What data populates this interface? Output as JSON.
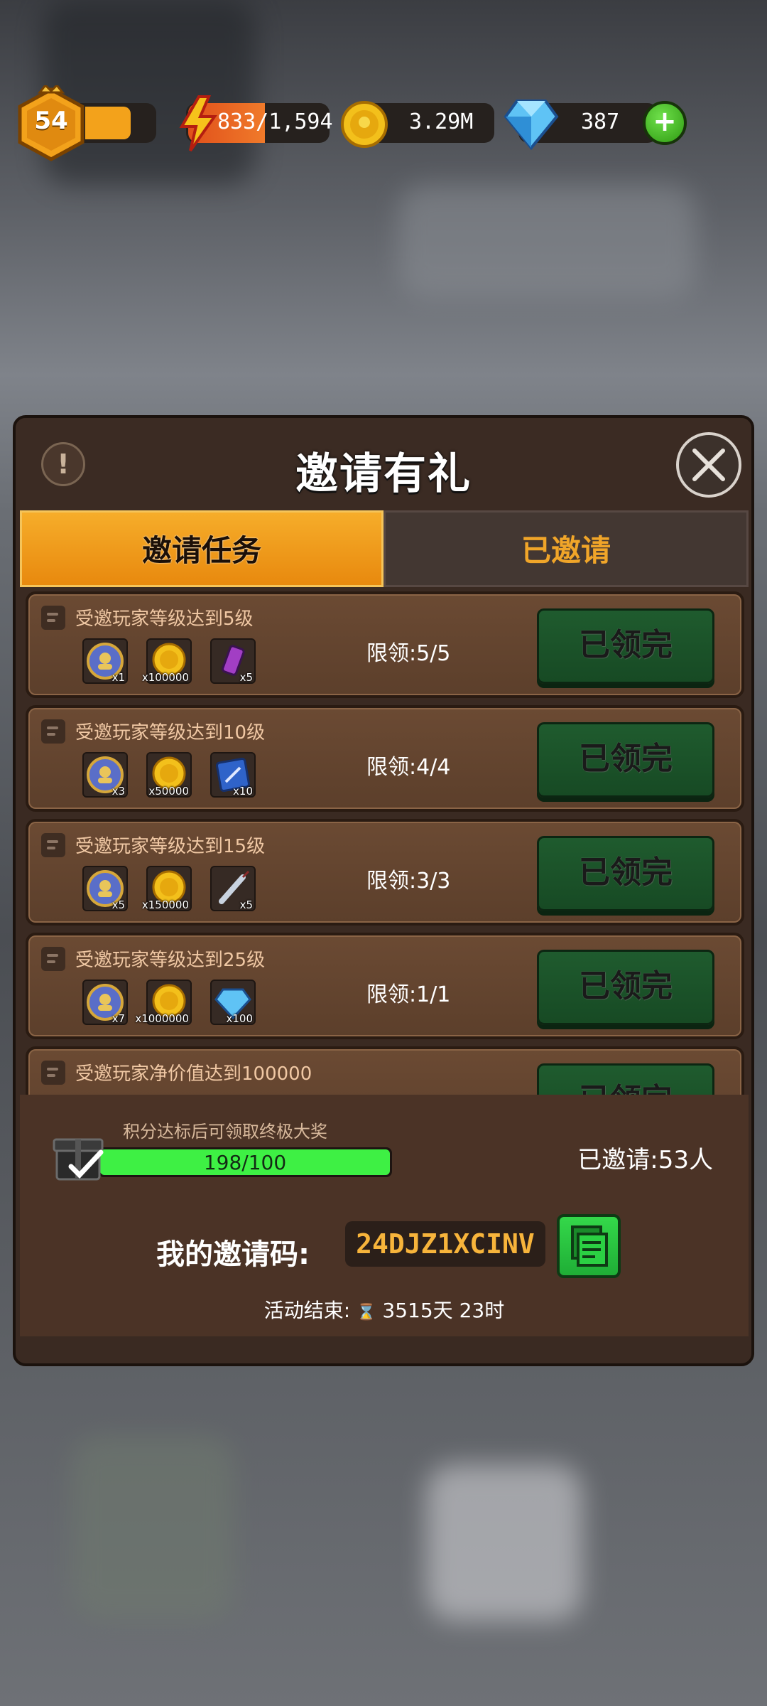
{
  "hud": {
    "level": "54",
    "energy": "833/1,594",
    "coins": "3.29M",
    "gems": "387",
    "add_gems": "+"
  },
  "dialog": {
    "title": "邀请有礼",
    "info_glyph": "!",
    "tabs": [
      {
        "label": "邀请任务",
        "active": true
      },
      {
        "label": "已邀请",
        "active": false
      }
    ],
    "rows": [
      {
        "title": "受邀玩家等级达到5级",
        "limit": "限领:5/5",
        "button": "已领完",
        "rewards": [
          {
            "icon": "emblem-icon",
            "qty": "x1"
          },
          {
            "icon": "gold-coin-icon",
            "qty": "x100000"
          },
          {
            "icon": "energy-can-icon",
            "qty": "x5"
          }
        ]
      },
      {
        "title": "受邀玩家等级达到10级",
        "limit": "限领:4/4",
        "button": "已领完",
        "rewards": [
          {
            "icon": "emblem-icon",
            "qty": "x3"
          },
          {
            "icon": "gold-coin-icon",
            "qty": "x50000"
          },
          {
            "icon": "blueprint-icon",
            "qty": "x10"
          }
        ]
      },
      {
        "title": "受邀玩家等级达到15级",
        "limit": "限领:3/3",
        "button": "已领完",
        "rewards": [
          {
            "icon": "emblem-icon",
            "qty": "x5"
          },
          {
            "icon": "gold-coin-icon",
            "qty": "x150000"
          },
          {
            "icon": "syringe-icon",
            "qty": "x5"
          }
        ]
      },
      {
        "title": "受邀玩家等级达到25级",
        "limit": "限领:1/1",
        "button": "已领完",
        "rewards": [
          {
            "icon": "emblem-icon",
            "qty": "x7"
          },
          {
            "icon": "gold-coin-icon",
            "qty": "x1000000"
          },
          {
            "icon": "diamond-icon",
            "qty": "x100"
          }
        ]
      },
      {
        "title": "受邀玩家净价值达到100000",
        "limit": "",
        "button": "已领完",
        "rewards": []
      }
    ],
    "footer": {
      "progress_label": "积分达标后可领取终极大奖",
      "progress_text": "198/100",
      "progress_fraction": 1.0,
      "invited": "已邀请:53人",
      "code_label": "我的邀请码:",
      "code": "24DJZ1XCINV",
      "end_label": "活动结束:",
      "end_time": "3515天 23时"
    }
  },
  "colors": {
    "accent_orange": "#f0a529",
    "claim_green": "#1f5b2e",
    "progress_green": "#3ef044",
    "panel_brown": "#5c3f2b"
  }
}
